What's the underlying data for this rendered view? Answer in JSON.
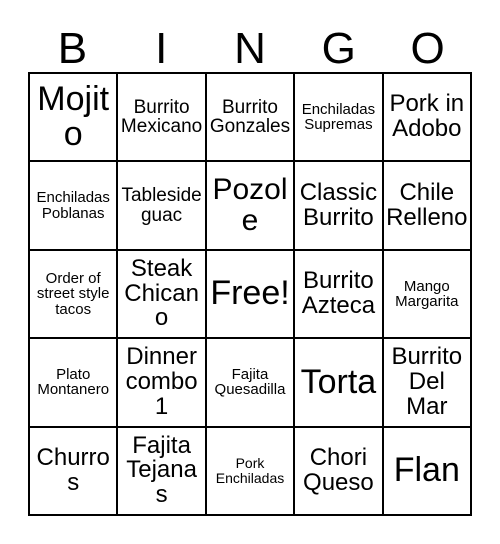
{
  "card": {
    "header_letters": [
      "B",
      "I",
      "N",
      "G",
      "O"
    ],
    "colors": {
      "border": "#000000",
      "cell_background": "#ffffff",
      "text": "#000000",
      "page_background": "#ffffff"
    },
    "rows": [
      [
        {
          "label": "Mojito",
          "size": "xl"
        },
        {
          "label": "Burrito Mexicano",
          "size": "sm"
        },
        {
          "label": "Burrito Gonzales",
          "size": "sm"
        },
        {
          "label": "Enchiladas Supremas",
          "size": "xs"
        },
        {
          "label": "Pork in Adobo",
          "size": "md"
        }
      ],
      [
        {
          "label": "Enchiladas Poblanas",
          "size": "xs"
        },
        {
          "label": "Tableside guac",
          "size": "sm"
        },
        {
          "label": "Pozole",
          "size": "lg"
        },
        {
          "label": "Classic Burrito",
          "size": "md"
        },
        {
          "label": "Chile Relleno",
          "size": "md"
        }
      ],
      [
        {
          "label": "Order of street style tacos",
          "size": "xs"
        },
        {
          "label": "Steak Chicano",
          "size": "md"
        },
        {
          "label": "Free!",
          "size": "xl"
        },
        {
          "label": "Burrito Azteca",
          "size": "md"
        },
        {
          "label": "Mango Margarita",
          "size": "xs"
        }
      ],
      [
        {
          "label": "Plato Montanero",
          "size": "xs"
        },
        {
          "label": "Dinner combo 1",
          "size": "md"
        },
        {
          "label": "Fajita Quesadilla",
          "size": "xs"
        },
        {
          "label": "Torta",
          "size": "xl"
        },
        {
          "label": "Burrito Del Mar",
          "size": "md"
        }
      ],
      [
        {
          "label": "Churros",
          "size": "md"
        },
        {
          "label": "Fajita Tejanas",
          "size": "md"
        },
        {
          "label": "Pork Enchiladas",
          "size": "xxs"
        },
        {
          "label": "Chori Queso",
          "size": "md"
        },
        {
          "label": "Flan",
          "size": "xl"
        }
      ]
    ]
  }
}
